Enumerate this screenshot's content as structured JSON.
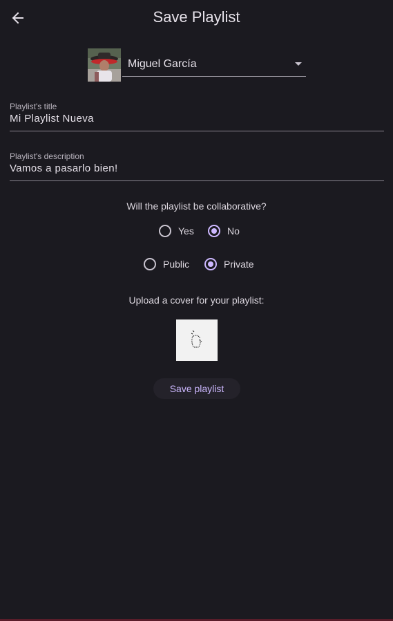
{
  "header": {
    "title": "Save Playlist",
    "back_icon": "arrow-left-icon"
  },
  "account": {
    "name": "Miguel García",
    "avatar_icon": "user-avatar"
  },
  "title_field": {
    "label": "Playlist's title",
    "value": "Mi Playlist Nueva"
  },
  "description_field": {
    "label": "Playlist's description",
    "value": "Vamos a pasarlo bien!"
  },
  "collaborative": {
    "question": "Will the playlist be collaborative?",
    "options": [
      {
        "label": "Yes",
        "checked": false
      },
      {
        "label": "No",
        "checked": true
      }
    ]
  },
  "visibility": {
    "options": [
      {
        "label": "Public",
        "checked": false
      },
      {
        "label": "Private",
        "checked": true
      }
    ]
  },
  "cover": {
    "label": "Upload a cover for your playlist:",
    "icon": "upload-cover-icon"
  },
  "actions": {
    "save_label": "Save playlist"
  },
  "colors": {
    "background": "#1b1a20",
    "accent": "#cdb8ff",
    "text": "#e6e1e9"
  }
}
